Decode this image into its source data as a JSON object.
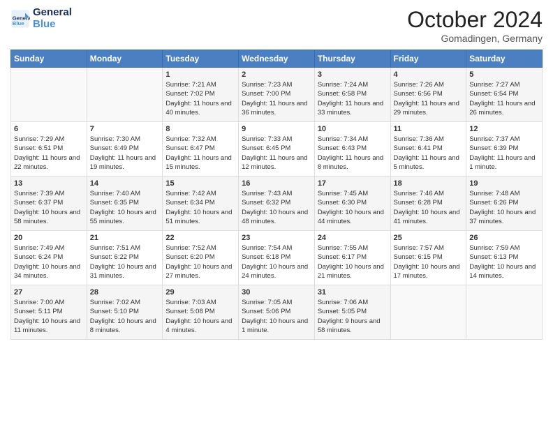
{
  "logo": {
    "line1": "General",
    "line2": "Blue"
  },
  "title": "October 2024",
  "location": "Gomadingen, Germany",
  "days_header": [
    "Sunday",
    "Monday",
    "Tuesday",
    "Wednesday",
    "Thursday",
    "Friday",
    "Saturday"
  ],
  "weeks": [
    [
      {
        "num": "",
        "sunrise": "",
        "sunset": "",
        "daylight": ""
      },
      {
        "num": "",
        "sunrise": "",
        "sunset": "",
        "daylight": ""
      },
      {
        "num": "1",
        "sunrise": "Sunrise: 7:21 AM",
        "sunset": "Sunset: 7:02 PM",
        "daylight": "Daylight: 11 hours and 40 minutes."
      },
      {
        "num": "2",
        "sunrise": "Sunrise: 7:23 AM",
        "sunset": "Sunset: 7:00 PM",
        "daylight": "Daylight: 11 hours and 36 minutes."
      },
      {
        "num": "3",
        "sunrise": "Sunrise: 7:24 AM",
        "sunset": "Sunset: 6:58 PM",
        "daylight": "Daylight: 11 hours and 33 minutes."
      },
      {
        "num": "4",
        "sunrise": "Sunrise: 7:26 AM",
        "sunset": "Sunset: 6:56 PM",
        "daylight": "Daylight: 11 hours and 29 minutes."
      },
      {
        "num": "5",
        "sunrise": "Sunrise: 7:27 AM",
        "sunset": "Sunset: 6:54 PM",
        "daylight": "Daylight: 11 hours and 26 minutes."
      }
    ],
    [
      {
        "num": "6",
        "sunrise": "Sunrise: 7:29 AM",
        "sunset": "Sunset: 6:51 PM",
        "daylight": "Daylight: 11 hours and 22 minutes."
      },
      {
        "num": "7",
        "sunrise": "Sunrise: 7:30 AM",
        "sunset": "Sunset: 6:49 PM",
        "daylight": "Daylight: 11 hours and 19 minutes."
      },
      {
        "num": "8",
        "sunrise": "Sunrise: 7:32 AM",
        "sunset": "Sunset: 6:47 PM",
        "daylight": "Daylight: 11 hours and 15 minutes."
      },
      {
        "num": "9",
        "sunrise": "Sunrise: 7:33 AM",
        "sunset": "Sunset: 6:45 PM",
        "daylight": "Daylight: 11 hours and 12 minutes."
      },
      {
        "num": "10",
        "sunrise": "Sunrise: 7:34 AM",
        "sunset": "Sunset: 6:43 PM",
        "daylight": "Daylight: 11 hours and 8 minutes."
      },
      {
        "num": "11",
        "sunrise": "Sunrise: 7:36 AM",
        "sunset": "Sunset: 6:41 PM",
        "daylight": "Daylight: 11 hours and 5 minutes."
      },
      {
        "num": "12",
        "sunrise": "Sunrise: 7:37 AM",
        "sunset": "Sunset: 6:39 PM",
        "daylight": "Daylight: 11 hours and 1 minute."
      }
    ],
    [
      {
        "num": "13",
        "sunrise": "Sunrise: 7:39 AM",
        "sunset": "Sunset: 6:37 PM",
        "daylight": "Daylight: 10 hours and 58 minutes."
      },
      {
        "num": "14",
        "sunrise": "Sunrise: 7:40 AM",
        "sunset": "Sunset: 6:35 PM",
        "daylight": "Daylight: 10 hours and 55 minutes."
      },
      {
        "num": "15",
        "sunrise": "Sunrise: 7:42 AM",
        "sunset": "Sunset: 6:34 PM",
        "daylight": "Daylight: 10 hours and 51 minutes."
      },
      {
        "num": "16",
        "sunrise": "Sunrise: 7:43 AM",
        "sunset": "Sunset: 6:32 PM",
        "daylight": "Daylight: 10 hours and 48 minutes."
      },
      {
        "num": "17",
        "sunrise": "Sunrise: 7:45 AM",
        "sunset": "Sunset: 6:30 PM",
        "daylight": "Daylight: 10 hours and 44 minutes."
      },
      {
        "num": "18",
        "sunrise": "Sunrise: 7:46 AM",
        "sunset": "Sunset: 6:28 PM",
        "daylight": "Daylight: 10 hours and 41 minutes."
      },
      {
        "num": "19",
        "sunrise": "Sunrise: 7:48 AM",
        "sunset": "Sunset: 6:26 PM",
        "daylight": "Daylight: 10 hours and 37 minutes."
      }
    ],
    [
      {
        "num": "20",
        "sunrise": "Sunrise: 7:49 AM",
        "sunset": "Sunset: 6:24 PM",
        "daylight": "Daylight: 10 hours and 34 minutes."
      },
      {
        "num": "21",
        "sunrise": "Sunrise: 7:51 AM",
        "sunset": "Sunset: 6:22 PM",
        "daylight": "Daylight: 10 hours and 31 minutes."
      },
      {
        "num": "22",
        "sunrise": "Sunrise: 7:52 AM",
        "sunset": "Sunset: 6:20 PM",
        "daylight": "Daylight: 10 hours and 27 minutes."
      },
      {
        "num": "23",
        "sunrise": "Sunrise: 7:54 AM",
        "sunset": "Sunset: 6:18 PM",
        "daylight": "Daylight: 10 hours and 24 minutes."
      },
      {
        "num": "24",
        "sunrise": "Sunrise: 7:55 AM",
        "sunset": "Sunset: 6:17 PM",
        "daylight": "Daylight: 10 hours and 21 minutes."
      },
      {
        "num": "25",
        "sunrise": "Sunrise: 7:57 AM",
        "sunset": "Sunset: 6:15 PM",
        "daylight": "Daylight: 10 hours and 17 minutes."
      },
      {
        "num": "26",
        "sunrise": "Sunrise: 7:59 AM",
        "sunset": "Sunset: 6:13 PM",
        "daylight": "Daylight: 10 hours and 14 minutes."
      }
    ],
    [
      {
        "num": "27",
        "sunrise": "Sunrise: 7:00 AM",
        "sunset": "Sunset: 5:11 PM",
        "daylight": "Daylight: 10 hours and 11 minutes."
      },
      {
        "num": "28",
        "sunrise": "Sunrise: 7:02 AM",
        "sunset": "Sunset: 5:10 PM",
        "daylight": "Daylight: 10 hours and 8 minutes."
      },
      {
        "num": "29",
        "sunrise": "Sunrise: 7:03 AM",
        "sunset": "Sunset: 5:08 PM",
        "daylight": "Daylight: 10 hours and 4 minutes."
      },
      {
        "num": "30",
        "sunrise": "Sunrise: 7:05 AM",
        "sunset": "Sunset: 5:06 PM",
        "daylight": "Daylight: 10 hours and 1 minute."
      },
      {
        "num": "31",
        "sunrise": "Sunrise: 7:06 AM",
        "sunset": "Sunset: 5:05 PM",
        "daylight": "Daylight: 9 hours and 58 minutes."
      },
      {
        "num": "",
        "sunrise": "",
        "sunset": "",
        "daylight": ""
      },
      {
        "num": "",
        "sunrise": "",
        "sunset": "",
        "daylight": ""
      }
    ]
  ]
}
